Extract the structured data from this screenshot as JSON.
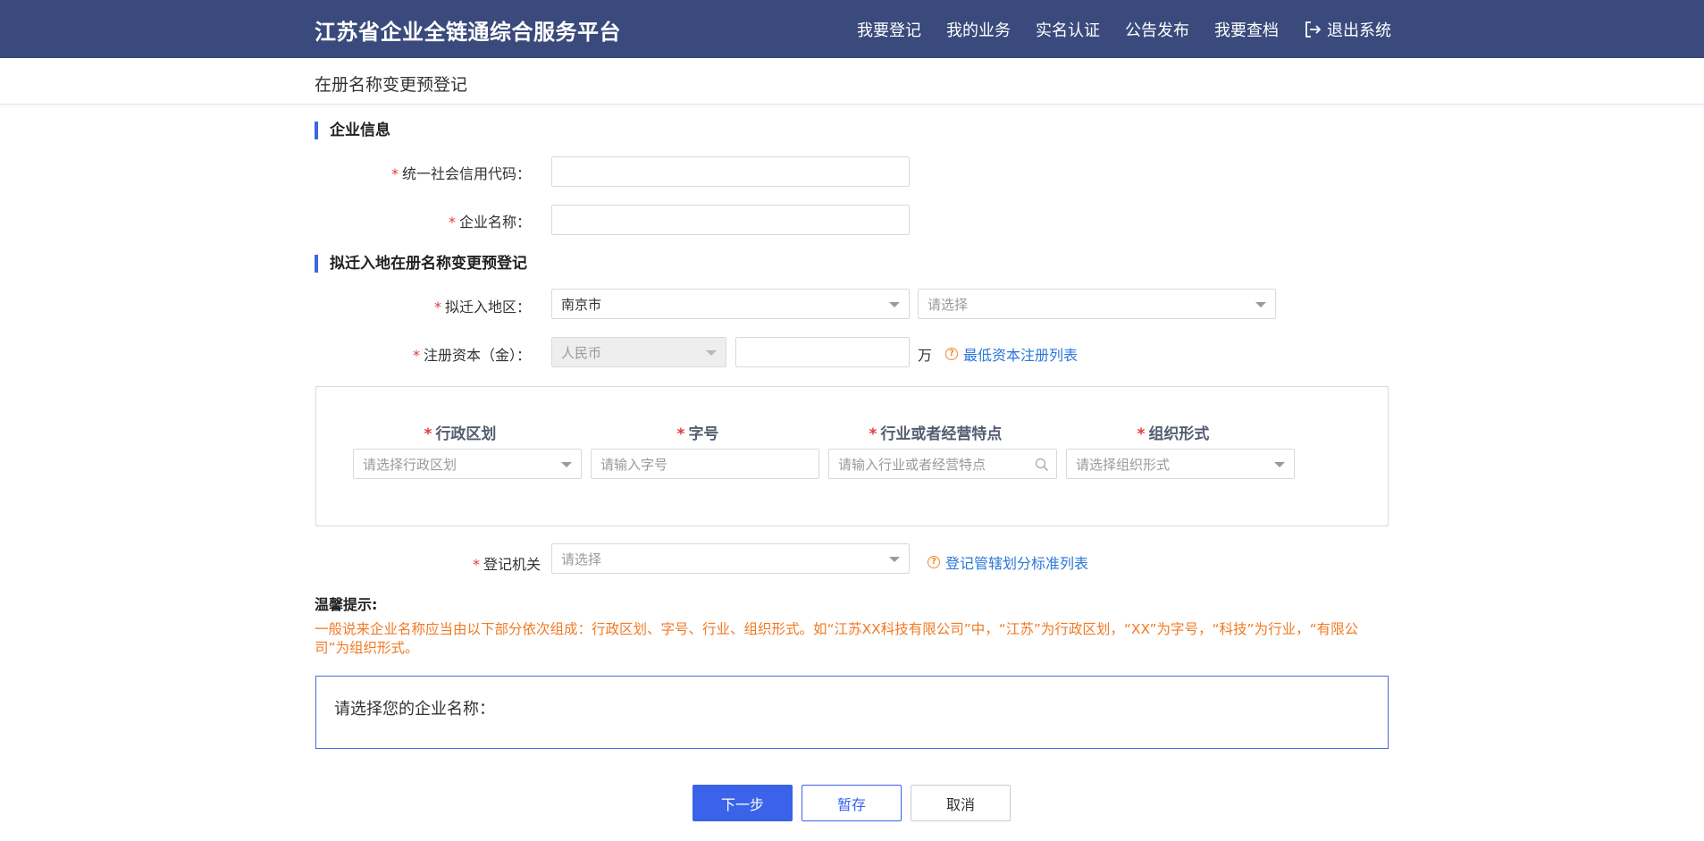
{
  "header": {
    "brand": "江苏省企业全链通综合服务平台",
    "nav": [
      "我要登记",
      "我的业务",
      "实名认证",
      "公告发布",
      "我要查档"
    ],
    "logout": "退出系统"
  },
  "subheader": {
    "title": "在册名称变更预登记"
  },
  "section_company": {
    "title": "企业信息",
    "credit_code_label": "统一社会信用代码：",
    "credit_code_value": "",
    "company_name_label": "企业名称：",
    "company_name_value": ""
  },
  "section_move": {
    "title": "拟迁入地在册名称变更预登记",
    "region_label": "拟迁入地区：",
    "region_city": "南京市",
    "region_district_placeholder": "请选择",
    "capital_label": "注册资本（金）：",
    "currency": "人民币",
    "capital_value": "",
    "capital_unit": "万",
    "capital_link": "最低资本注册列表"
  },
  "name_parts": {
    "admin_div": {
      "label": "行政区划",
      "placeholder": "请选择行政区划"
    },
    "trade_name": {
      "label": "字号",
      "placeholder": "请输入字号"
    },
    "industry": {
      "label": "行业或者经营特点",
      "placeholder": "请输入行业或者经营特点"
    },
    "org_form": {
      "label": "组织形式",
      "placeholder": "请选择组织形式"
    }
  },
  "authority": {
    "label": "登记机关",
    "placeholder": "请选择",
    "link": "登记管辖划分标准列表"
  },
  "tips": {
    "title": "温馨提示:",
    "text": "一般说来企业名称应当由以下部分依次组成：行政区划、字号、行业、组织形式。如“江苏XX科技有限公司”中，“江苏”为行政区划，“XX”为字号，“科技”为行业，“有限公司”为组织形式。"
  },
  "choose_name": {
    "label": "请选择您的企业名称："
  },
  "buttons": {
    "next": "下一步",
    "save": "暂存",
    "cancel": "取消"
  },
  "colors": {
    "header_bg": "#3b4a7c",
    "accent": "#3a63ea",
    "required": "#e4393c",
    "tip": "#f07a24",
    "link": "#2b77d9"
  }
}
